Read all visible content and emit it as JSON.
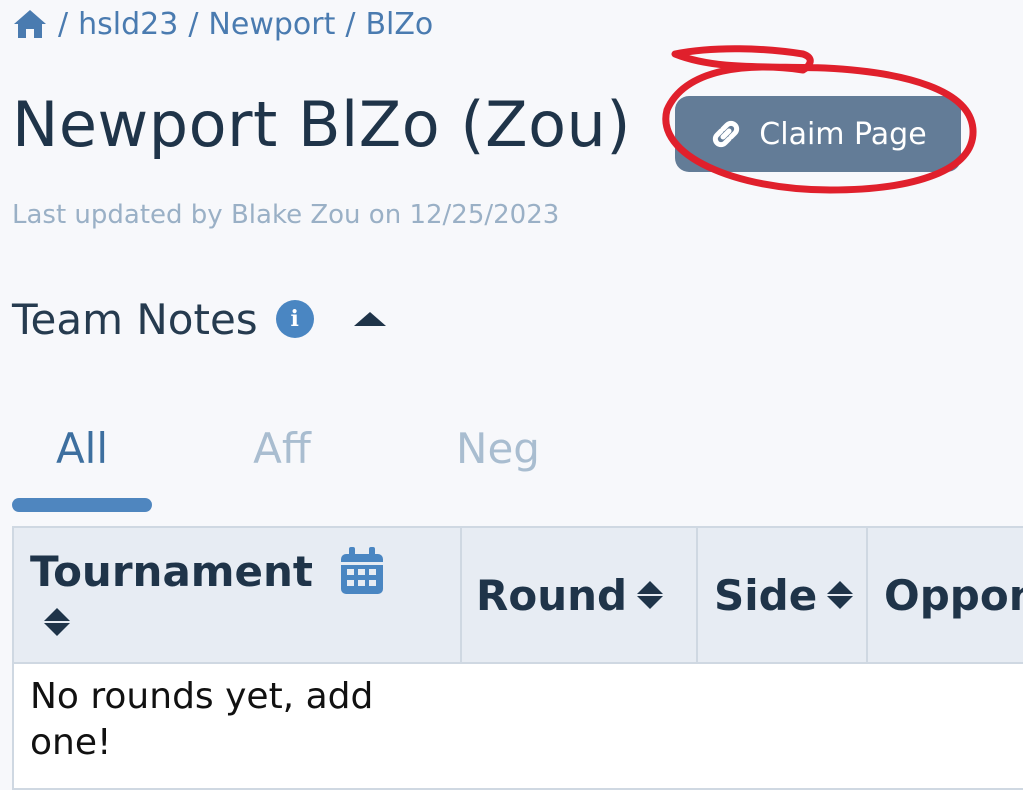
{
  "breadcrumb": {
    "home_icon": "home-icon",
    "separator": "/",
    "items": [
      "hsld23",
      "Newport",
      "BlZo"
    ]
  },
  "header": {
    "title": "Newport BlZo (Zou)",
    "claim_button": {
      "label": "Claim Page",
      "icon": "link-icon"
    },
    "last_updated": "Last updated by Blake Zou on 12/25/2023"
  },
  "team_notes": {
    "title": "Team Notes",
    "info_icon": "info-icon",
    "toggle_icon": "caret-up-icon"
  },
  "tabs": [
    {
      "label": "All",
      "active": true
    },
    {
      "label": "Aff",
      "active": false
    },
    {
      "label": "Neg",
      "active": false
    }
  ],
  "table": {
    "columns": [
      "Tournament",
      "Round",
      "Side",
      "Oppon"
    ],
    "tournament_icon": "calendar-icon",
    "empty_message": "No rounds yet, add one!"
  },
  "colors": {
    "accent": "#4a7bb0",
    "button": "#637c97",
    "annotation": "#e0202c",
    "title": "#1f3449",
    "muted": "#9ab0c6"
  }
}
